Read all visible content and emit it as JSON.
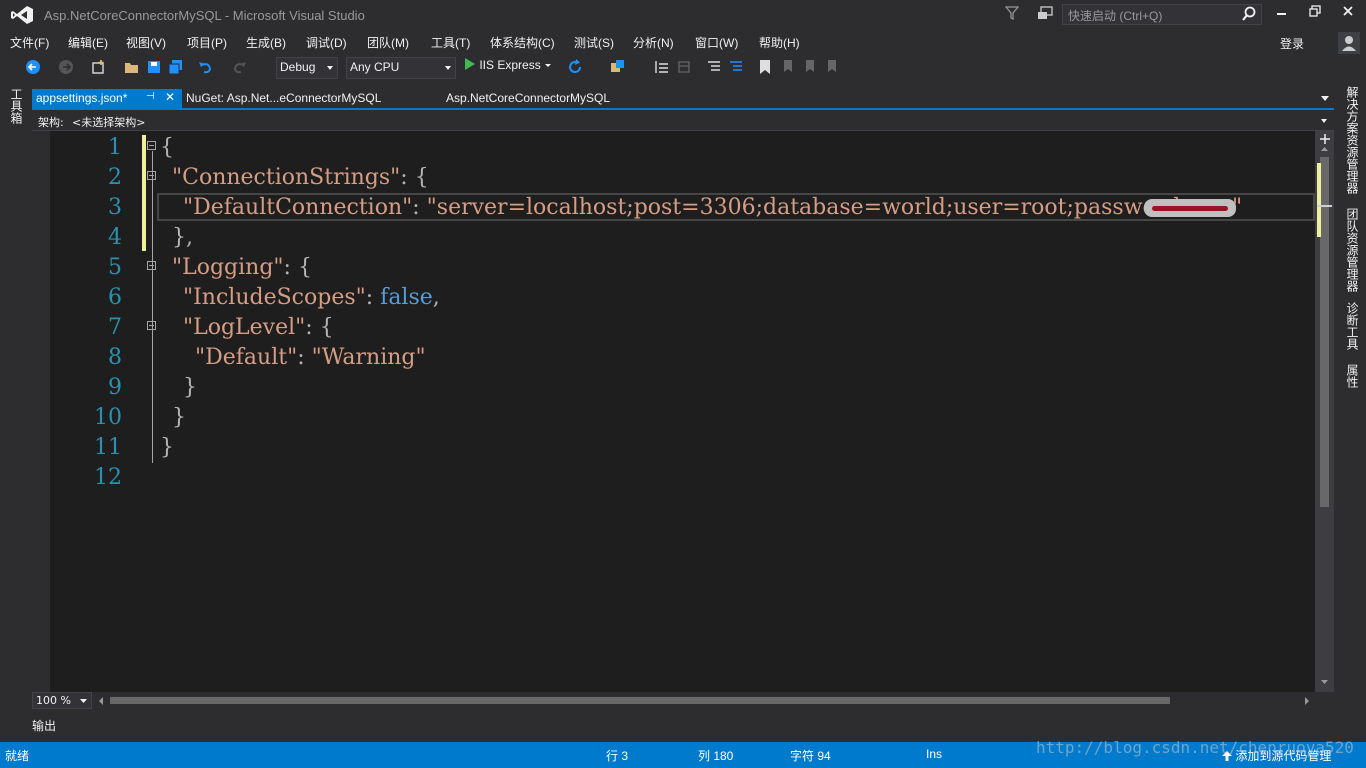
{
  "window": {
    "title": "Asp.NetCoreConnectorMySQL - Microsoft Visual Studio",
    "quick_launch_placeholder": "快速启动 (Ctrl+Q)",
    "login_label": "登录"
  },
  "menu": [
    "文件(F)",
    "编辑(E)",
    "视图(V)",
    "项目(P)",
    "生成(B)",
    "调试(D)",
    "团队(M)",
    "工具(T)",
    "体系结构(C)",
    "测试(S)",
    "分析(N)",
    "窗口(W)",
    "帮助(H)"
  ],
  "toolbar": {
    "configuration": "Debug",
    "platform": "Any CPU",
    "run_label": "IIS Express"
  },
  "left_strip": {
    "toolbox_label": "工具箱"
  },
  "tabs": [
    {
      "label": "appsettings.json*",
      "active": true
    },
    {
      "label": "NuGet: Asp.Net...eConnectorMySQL",
      "active": false
    },
    {
      "label": "Asp.NetCoreConnectorMySQL",
      "active": false
    }
  ],
  "schema_bar": {
    "label": "架构:",
    "value": "<未选择架构>"
  },
  "editor": {
    "line_numbers": [
      "1",
      "2",
      "3",
      "4",
      "5",
      "6",
      "7",
      "8",
      "9",
      "10",
      "11",
      "12"
    ],
    "code": {
      "l1": "{",
      "l2_key": "\"ConnectionStrings\"",
      "l2_rest": ": {",
      "l3_key": "\"DefaultConnection\"",
      "l3_colon": ": ",
      "l3_val": "\"server=localhost;post=3306;database=world;user=root;password=",
      "l3_end": "\"",
      "l4": "},",
      "l5_key": "\"Logging\"",
      "l5_rest": ": {",
      "l6_key": "\"IncludeScopes\"",
      "l6_colon": ": ",
      "l6_val": "false",
      "l6_end": ",",
      "l7_key": "\"LogLevel\"",
      "l7_rest": ": {",
      "l8_key": "\"Default\"",
      "l8_colon": ": ",
      "l8_val": "\"Warning\"",
      "l9": "}",
      "l10": "}",
      "l11": "}"
    }
  },
  "zoom": "100 %",
  "output_label": "输出",
  "right_strip": [
    "解决方案资源管理器",
    "团队资源管理器",
    "诊断工具",
    "属性"
  ],
  "status": {
    "ready": "就绪",
    "row": "行 3",
    "col": "列 180",
    "char": "字符 94",
    "mode": "Ins",
    "source_control": "添加到源代码管理"
  },
  "watermark": "http://blog.csdn.net/chenruoya520",
  "colors": {
    "accent": "#007acc",
    "editor_bg": "#1e1e1e",
    "string": "#d69d85",
    "keyword": "#569cd6",
    "line_number": "#2b91af"
  },
  "icons": [
    "vs-logo-icon",
    "filter-icon",
    "feedback-icon",
    "search-icon",
    "minimize-icon",
    "maximize-icon",
    "close-icon",
    "back-icon",
    "forward-icon",
    "new-project-icon",
    "open-icon",
    "save-icon",
    "save-all-icon",
    "undo-icon",
    "redo-icon",
    "play-icon",
    "refresh-icon",
    "bookmark-icon"
  ]
}
